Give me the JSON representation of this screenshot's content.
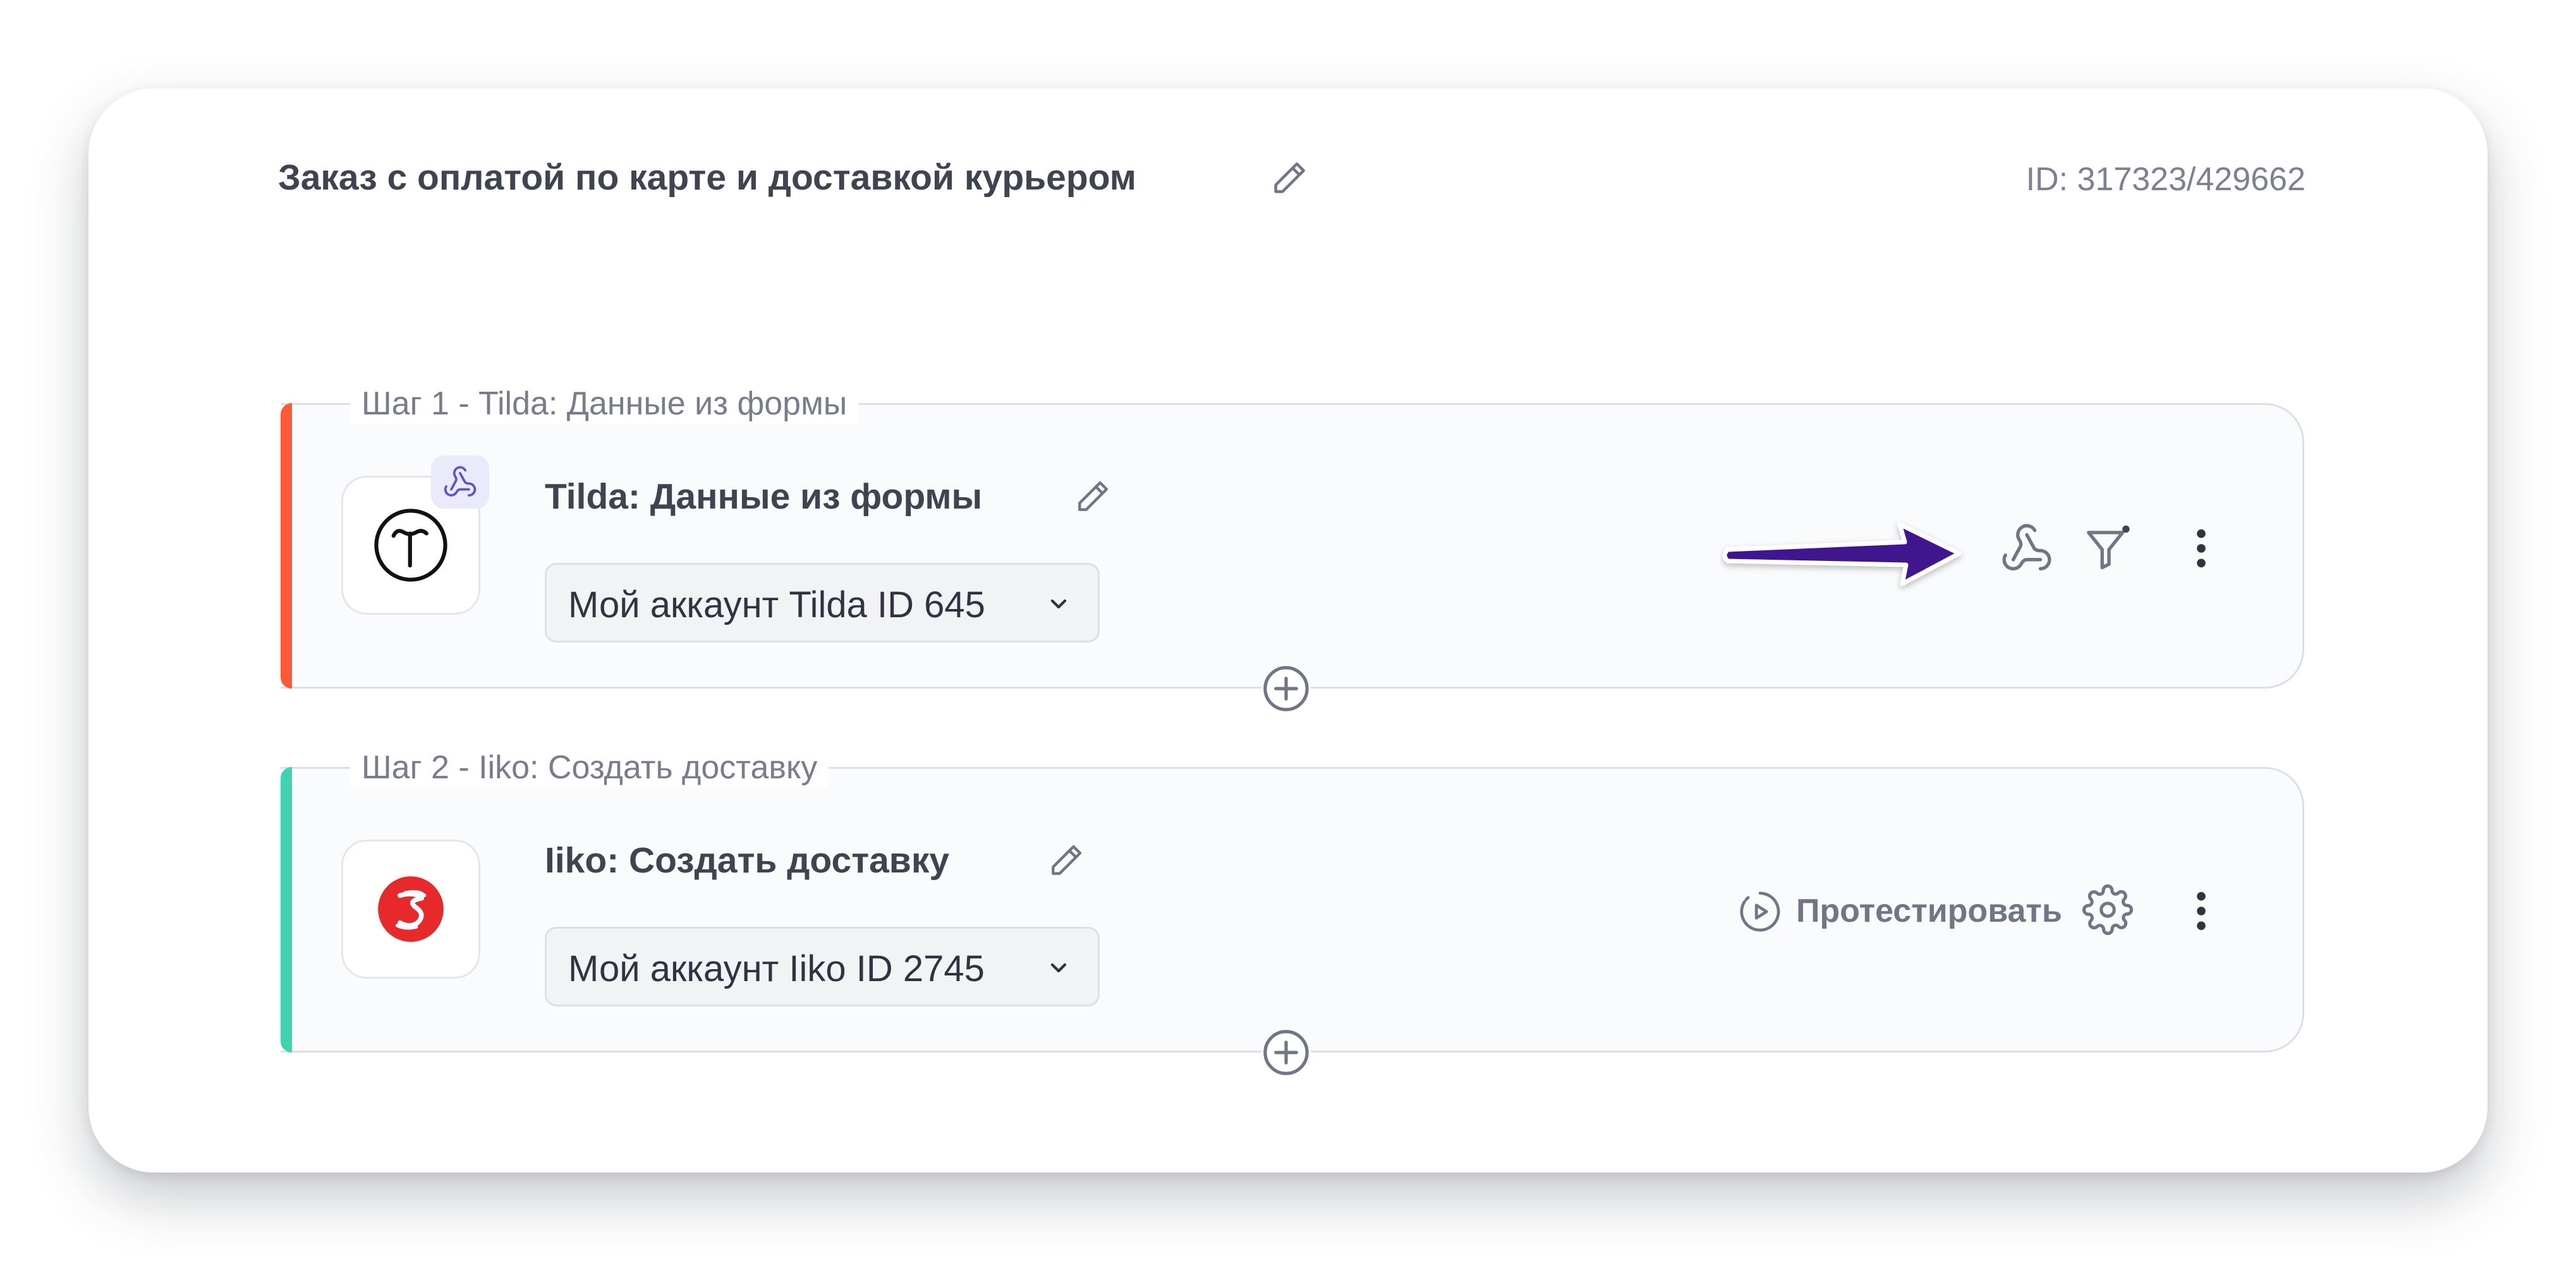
{
  "scenario": {
    "title": "Заказ с оплатой по карте и доставкой курьером",
    "id_label": "ID: 317323/429662"
  },
  "steps": [
    {
      "legend": "Шаг 1 - Tilda: Данные из формы",
      "name": "Tilda: Данные из формы",
      "account": "Мой аккаунт Tilda ID 645",
      "accent_color": "#ff5a36",
      "logo_icon": "tilda-logo-icon",
      "trigger_badge_icon": "webhook-icon",
      "actions": [
        "webhook-icon",
        "filter-icon",
        "more-vertical-icon"
      ]
    },
    {
      "legend": "Шаг 2 - Iiko: Создать доставку",
      "name": "Iiko: Создать доставку",
      "account": "Мой аккаунт Iiko ID 2745",
      "accent_color": "#3fd3b0",
      "logo_icon": "iiko-logo-icon",
      "test_label": "Протестировать",
      "actions": [
        "play-circle-icon",
        "gear-icon",
        "more-vertical-icon"
      ]
    }
  ],
  "annotation": {
    "arrow_color": "#40128f",
    "points_to": "webhook-icon"
  },
  "colors": {
    "text_primary": "#3e4550",
    "text_muted": "#777d8a",
    "icon_gray": "#6f7685",
    "card_border": "#dcdfe5"
  }
}
